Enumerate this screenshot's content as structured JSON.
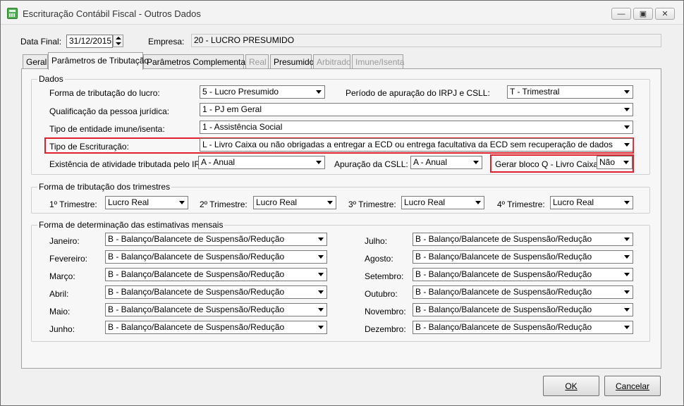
{
  "window": {
    "title": "Escrituração Contábil Fiscal - Outros Dados"
  },
  "header": {
    "date_label": "Data Final:",
    "date_value": "31/12/2015",
    "company_label": "Empresa:",
    "company_value": "20 - LUCRO PRESUMIDO"
  },
  "tabs": [
    {
      "label": "Geral",
      "state": "normal"
    },
    {
      "label": "Parâmetros de Tributação",
      "state": "active"
    },
    {
      "label": "Parâmetros Complementares",
      "state": "normal"
    },
    {
      "label": "Real",
      "state": "disabled"
    },
    {
      "label": "Presumido",
      "state": "normal"
    },
    {
      "label": "Arbitrado",
      "state": "disabled"
    },
    {
      "label": "Imune/Isenta",
      "state": "disabled"
    }
  ],
  "dados": {
    "title": "Dados",
    "forma_label": "Forma de tributação do lucro:",
    "forma_value": "5 - Lucro Presumido",
    "periodo_label": "Período de apuração do IRPJ e CSLL:",
    "periodo_value": "T - Trimestral",
    "qualificacao_label": "Qualificação da pessoa jurídica:",
    "qualificacao_value": "1 - PJ em Geral",
    "tipo_entidade_label": "Tipo de entidade imune/isenta:",
    "tipo_entidade_value": "1 - Assistência Social",
    "tipo_escrit_label": "Tipo de Escrituração:",
    "tipo_escrit_value": "L - Livro Caixa ou não obrigadas a entregar a ECD ou entrega facultativa da ECD sem recuperação de dados",
    "existencia_label": "Existência de atividade tributada pelo IRPJ:",
    "existencia_value": "A - Anual",
    "apuracao_label": "Apuração da CSLL:",
    "apuracao_value": "A - Anual",
    "bloco_q_label": "Gerar bloco Q - Livro Caixa:",
    "bloco_q_value": "Não"
  },
  "trimestres": {
    "title": "Forma de tributação dos trimestres",
    "items": [
      {
        "label": "1º Trimestre:",
        "value": "Lucro Real"
      },
      {
        "label": "2º Trimestre:",
        "value": "Lucro Real"
      },
      {
        "label": "3º Trimestre:",
        "value": "Lucro Real"
      },
      {
        "label": "4º Trimestre:",
        "value": "Lucro Real"
      }
    ]
  },
  "estimativas": {
    "title": "Forma de determinação das estimativas mensais",
    "months": [
      {
        "label": "Janeiro:",
        "value": "B - Balanço/Balancete de Suspensão/Redução"
      },
      {
        "label": "Fevereiro:",
        "value": "B - Balanço/Balancete de Suspensão/Redução"
      },
      {
        "label": "Março:",
        "value": "B - Balanço/Balancete de Suspensão/Redução"
      },
      {
        "label": "Abril:",
        "value": "B - Balanço/Balancete de Suspensão/Redução"
      },
      {
        "label": "Maio:",
        "value": "B - Balanço/Balancete de Suspensão/Redução"
      },
      {
        "label": "Junho:",
        "value": "B - Balanço/Balancete de Suspensão/Redução"
      },
      {
        "label": "Julho:",
        "value": "B - Balanço/Balancete de Suspensão/Redução"
      },
      {
        "label": "Agosto:",
        "value": "B - Balanço/Balancete de Suspensão/Redução"
      },
      {
        "label": "Setembro:",
        "value": "B - Balanço/Balancete de Suspensão/Redução"
      },
      {
        "label": "Outubro:",
        "value": "B - Balanço/Balancete de Suspensão/Redução"
      },
      {
        "label": "Novembro:",
        "value": "B - Balanço/Balancete de Suspensão/Redução"
      },
      {
        "label": "Dezembro:",
        "value": "B - Balanço/Balancete de Suspensão/Redução"
      }
    ]
  },
  "buttons": {
    "ok": "OK",
    "cancel": "Cancelar"
  },
  "icons": {
    "app": "spreadsheet-icon",
    "minimize": "minimize-icon",
    "maximize": "maximize-icon",
    "close": "close-icon"
  },
  "colors": {
    "highlight": "#e0202a"
  }
}
